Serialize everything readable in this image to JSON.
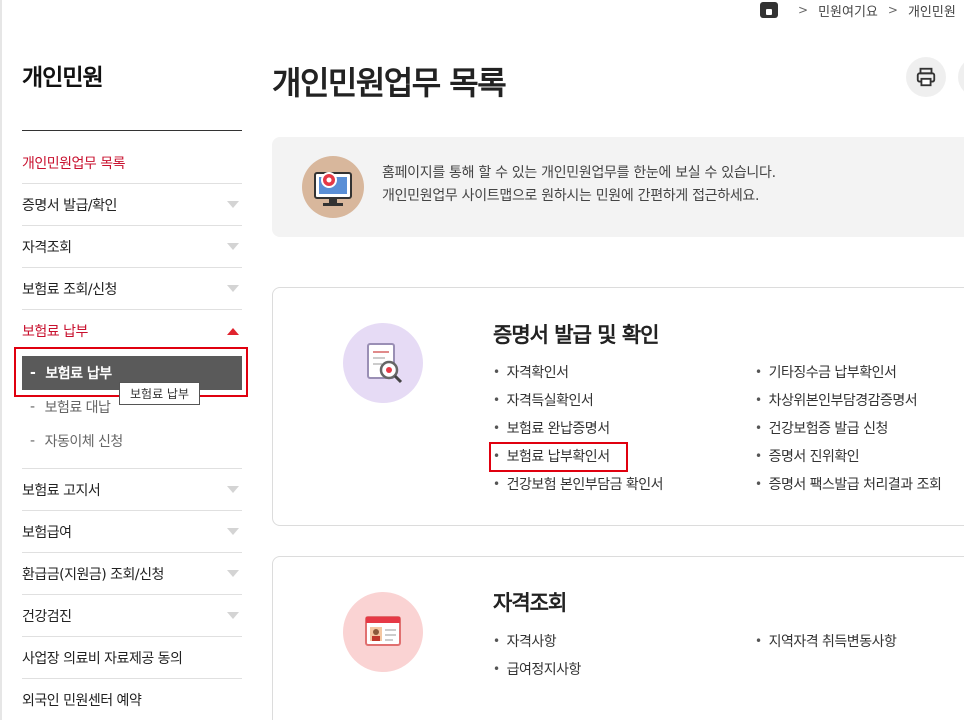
{
  "breadcrumb": {
    "items": [
      "민원여기요",
      "개인민원",
      "개"
    ]
  },
  "sidebar": {
    "title": "개인민원",
    "items": [
      {
        "label": "개인민원업무 목록",
        "active": true
      },
      {
        "label": "증명서 발급/확인"
      },
      {
        "label": "자격조회"
      },
      {
        "label": "보험료 조회/신청"
      },
      {
        "label": "보험료 납부",
        "active": true,
        "expanded": true
      },
      {
        "label": "보험료 고지서"
      },
      {
        "label": "보험급여"
      },
      {
        "label": "환급금(지원금) 조회/신청"
      },
      {
        "label": "건강검진"
      },
      {
        "label": "사업장 의료비 자료제공 동의"
      },
      {
        "label": "외국인 민원센터 예약"
      }
    ],
    "sub_items": [
      {
        "label": "보험료 납부",
        "selected": true
      },
      {
        "label": "보험료 대납"
      },
      {
        "label": "자동이체 신청"
      }
    ],
    "tooltip": "보험료 납부"
  },
  "main": {
    "title": "개인민원업무 목록",
    "info": {
      "line1": "홈페이지를 통해 할 수 있는 개인민원업무를 한눈에 보실 수 있습니다.",
      "line2": "개인민원업무 사이트맵으로 원하시는 민원에 간편하게 접근하세요."
    },
    "cards": [
      {
        "title": "증명서 발급 및 확인",
        "links": [
          "자격확인서",
          "기타징수금 납부확인서",
          "자격득실확인서",
          "차상위본인부담경감증명서",
          "보험료 완납증명서",
          "건강보험증 발급 신청",
          "보험료 납부확인서",
          "증명서 진위확인",
          "건강보험 본인부담금 확인서",
          "증명서 팩스발급 처리결과 조회"
        ]
      },
      {
        "title": "자격조회",
        "links": [
          "자격사항",
          "지역자격 취득변동사항",
          "급여정지사항"
        ]
      }
    ]
  },
  "colors": {
    "accent_red": "#c8102e",
    "highlight_box": "#e0000f",
    "selected_bg": "#5a5a5a"
  }
}
